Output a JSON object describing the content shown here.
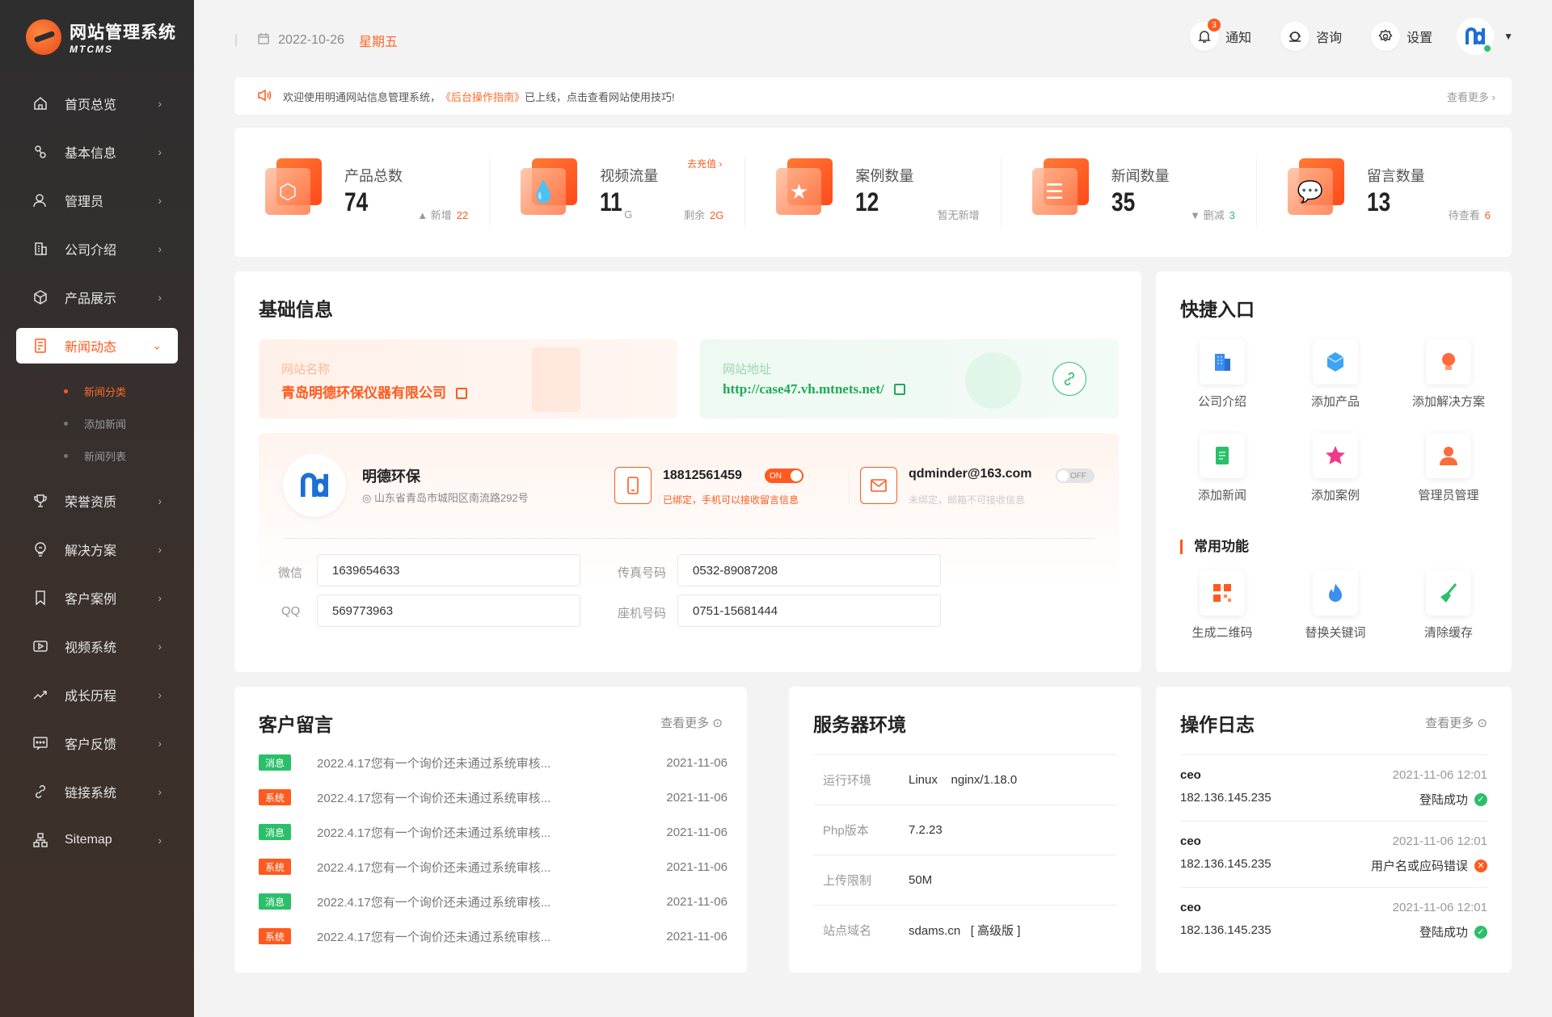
{
  "app": {
    "title": "网站管理系统",
    "subtitle": "MTCMS"
  },
  "colors": {
    "accent": "#ff5a1f",
    "green": "#2bbf6a",
    "sidebar": "#2e2e2e"
  },
  "sidebar": {
    "items": [
      {
        "label": "首页总览",
        "icon": "home-icon"
      },
      {
        "label": "基本信息",
        "icon": "info-icon"
      },
      {
        "label": "管理员",
        "icon": "user-icon"
      },
      {
        "label": "公司介绍",
        "icon": "building-icon"
      },
      {
        "label": "产品展示",
        "icon": "box-icon"
      },
      {
        "label": "新闻动态",
        "icon": "news-icon",
        "active": true
      },
      {
        "label": "荣誉资质",
        "icon": "trophy-icon"
      },
      {
        "label": "解决方案",
        "icon": "lightbulb-icon"
      },
      {
        "label": "客户案例",
        "icon": "bookmark-icon"
      },
      {
        "label": "视频系统",
        "icon": "video-icon"
      },
      {
        "label": "成长历程",
        "icon": "trend-icon"
      },
      {
        "label": "客户反馈",
        "icon": "chat-icon"
      },
      {
        "label": "链接系统",
        "icon": "link-icon"
      },
      {
        "label": "Sitemap",
        "icon": "sitemap-icon"
      }
    ],
    "subitems": [
      {
        "label": "新闻分类",
        "active": true
      },
      {
        "label": "添加新闻"
      },
      {
        "label": "新闻列表"
      }
    ]
  },
  "header": {
    "date": "2022-10-26",
    "weekday": "星期五",
    "notify_label": "通知",
    "notify_count": "3",
    "consult_label": "咨询",
    "settings_label": "设置"
  },
  "notice": {
    "prefix": "欢迎使用明通网站信息管理系统，",
    "highlight": "《后台操作指南》",
    "suffix": "已上线，点击查看网站使用技巧!",
    "more": "查看更多 ›"
  },
  "stats": [
    {
      "label": "产品总数",
      "value": "74",
      "unit": "",
      "side_prefix": "▲ 新增",
      "side_value": "22",
      "icon": "cube-icon"
    },
    {
      "label": "视频流量",
      "value": "11",
      "unit": "G",
      "top_link": "去充值 ›",
      "side_prefix": "剩余",
      "side_value": "2G",
      "icon": "drop-icon"
    },
    {
      "label": "案例数量",
      "value": "12",
      "unit": "",
      "side_prefix": "暂无新增",
      "side_value": "",
      "icon": "star-icon"
    },
    {
      "label": "新闻数量",
      "value": "35",
      "unit": "",
      "side_prefix": "▼ 删减",
      "side_value": "3",
      "icon": "doc-icon"
    },
    {
      "label": "留言数量",
      "value": "13",
      "unit": "",
      "side_prefix": "待查看",
      "side_value": "6",
      "icon": "message-icon"
    }
  ],
  "basic": {
    "title": "基础信息",
    "site_name_label": "网站名称",
    "site_name": "青岛明德环保仪器有限公司",
    "site_url_label": "网站地址",
    "site_url": "http://case47.vh.mtnets.net/",
    "company": "明德环保",
    "address": "山东省青岛市城阳区南流路292号",
    "phone": "18812561459",
    "phone_toggle": "ON",
    "phone_note": "已绑定，手机可以接收留言信息",
    "email": "qdminder@163.com",
    "email_toggle": "OFF",
    "email_note": "未绑定，邮箱不可接收信息",
    "wechat_label": "微信",
    "wechat": "1639654633",
    "fax_label": "传真号码",
    "fax": "0532-89087208",
    "qq_label": "QQ",
    "qq": "569773963",
    "landline_label": "座机号码",
    "landline": "0751-15681444"
  },
  "quick": {
    "title": "快捷入口",
    "items": [
      "公司介绍",
      "添加产品",
      "添加解决方案",
      "添加新闻",
      "添加案例",
      "管理员管理"
    ],
    "common_title": "常用功能",
    "common": [
      "生成二维码",
      "替换关键词",
      "清除缓存"
    ]
  },
  "messages": {
    "title": "客户留言",
    "more": "查看更多",
    "rows": [
      {
        "tag": "消息",
        "text": "2022.4.17您有一个询价还未通过系统审核...",
        "date": "2021-11-06"
      },
      {
        "tag": "系统",
        "text": "2022.4.17您有一个询价还未通过系统审核...",
        "date": "2021-11-06"
      },
      {
        "tag": "消息",
        "text": "2022.4.17您有一个询价还未通过系统审核...",
        "date": "2021-11-06"
      },
      {
        "tag": "系统",
        "text": "2022.4.17您有一个询价还未通过系统审核...",
        "date": "2021-11-06"
      },
      {
        "tag": "消息",
        "text": "2022.4.17您有一个询价还未通过系统审核...",
        "date": "2021-11-06"
      },
      {
        "tag": "系统",
        "text": "2022.4.17您有一个询价还未通过系统审核...",
        "date": "2021-11-06"
      }
    ]
  },
  "server": {
    "title": "服务器环境",
    "rows": [
      {
        "k": "运行环境",
        "v": "Linux    nginx/1.18.0"
      },
      {
        "k": "Php版本",
        "v": "7.2.23"
      },
      {
        "k": "上传限制",
        "v": "50M"
      },
      {
        "k": "站点域名",
        "v": "sdams.cn   [ 高级版 ]"
      }
    ]
  },
  "log": {
    "title": "操作日志",
    "more": "查看更多",
    "rows": [
      {
        "user": "ceo",
        "ip": "182.136.145.235",
        "time": "2021-11-06 12:01",
        "status": "登陆成功",
        "ok": true
      },
      {
        "user": "ceo",
        "ip": "182.136.145.235",
        "time": "2021-11-06 12:01",
        "status": "用户名或应码错误",
        "ok": false
      },
      {
        "user": "ceo",
        "ip": "182.136.145.235",
        "time": "2021-11-06 12:01",
        "status": "登陆成功",
        "ok": true
      }
    ]
  }
}
